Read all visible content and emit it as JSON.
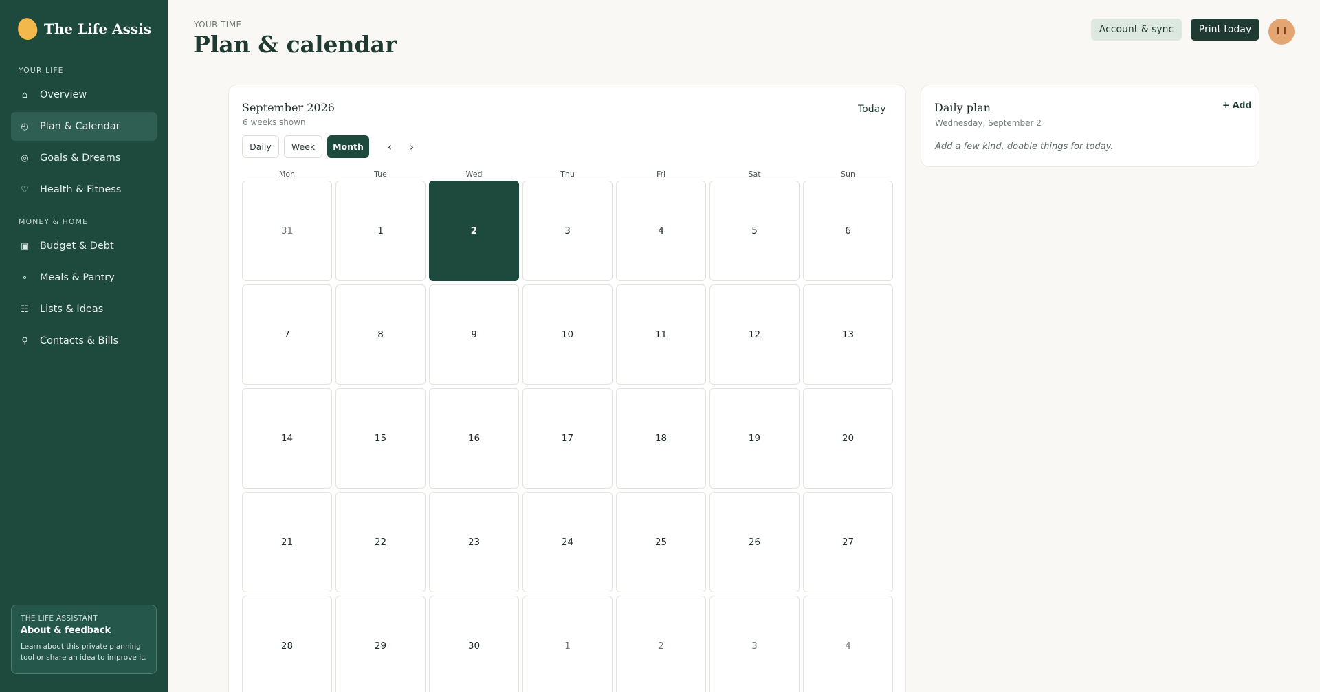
{
  "app": {
    "brand": "The Life Assist..."
  },
  "sidebar": {
    "section_life": "YOUR LIFE",
    "section_money": "MONEY & HOME",
    "items": [
      {
        "label": "Overview",
        "icon": "⌂",
        "icon_name": "home-icon"
      },
      {
        "label": "Plan & Calendar",
        "icon": "◴",
        "icon_name": "clock-icon"
      },
      {
        "label": "Goals & Dreams",
        "icon": "◎",
        "icon_name": "target-icon"
      },
      {
        "label": "Health & Fitness",
        "icon": "♡",
        "icon_name": "heart-icon"
      },
      {
        "label": "Budget & Debt",
        "icon": "▣",
        "icon_name": "wallet-icon"
      },
      {
        "label": "Meals & Pantry",
        "icon": "∘",
        "icon_name": "bowl-icon"
      },
      {
        "label": "Lists & Ideas",
        "icon": "☷",
        "icon_name": "list-icon"
      },
      {
        "label": "Contacts & Bills",
        "icon": "⚲",
        "icon_name": "contacts-icon"
      }
    ],
    "active_item": "Plan & Calendar",
    "about": {
      "kicker": "THE LIFE ASSISTANT",
      "title": "About & feedback",
      "description": "Learn about this private planning tool or share an idea to improve it."
    }
  },
  "header": {
    "kicker": "YOUR TIME",
    "title": "Plan & calendar",
    "account_label": "Account & sync",
    "print_label": "Print today",
    "avatar_initials": "I I"
  },
  "calendar": {
    "month_label": "September 2026",
    "subtitle": "6 weeks shown",
    "today_label": "Today",
    "views": [
      "Daily",
      "Week",
      "Month"
    ],
    "active_view": "Month",
    "prev_icon": "‹",
    "next_icon": "›",
    "weekdays": [
      "Mon",
      "Tue",
      "Wed",
      "Thu",
      "Fri",
      "Sat",
      "Sun"
    ],
    "weeks": [
      [
        {
          "d": "31",
          "m": true
        },
        {
          "d": "1"
        },
        {
          "d": "2",
          "t": true
        },
        {
          "d": "3"
        },
        {
          "d": "4"
        },
        {
          "d": "5"
        },
        {
          "d": "6"
        }
      ],
      [
        {
          "d": "7"
        },
        {
          "d": "8"
        },
        {
          "d": "9"
        },
        {
          "d": "10"
        },
        {
          "d": "11"
        },
        {
          "d": "12"
        },
        {
          "d": "13"
        }
      ],
      [
        {
          "d": "14"
        },
        {
          "d": "15"
        },
        {
          "d": "16"
        },
        {
          "d": "17"
        },
        {
          "d": "18"
        },
        {
          "d": "19"
        },
        {
          "d": "20"
        }
      ],
      [
        {
          "d": "21"
        },
        {
          "d": "22"
        },
        {
          "d": "23"
        },
        {
          "d": "24"
        },
        {
          "d": "25"
        },
        {
          "d": "26"
        },
        {
          "d": "27"
        }
      ],
      [
        {
          "d": "28"
        },
        {
          "d": "29"
        },
        {
          "d": "30"
        },
        {
          "d": "1",
          "m": true
        },
        {
          "d": "2",
          "m": true
        },
        {
          "d": "3",
          "m": true
        },
        {
          "d": "4",
          "m": true
        }
      ]
    ]
  },
  "daily_plan": {
    "title": "Daily plan",
    "date": "Wednesday, September 2",
    "add_label": "+ Add",
    "empty_text": "Add a few kind, doable things for today."
  },
  "colors": {
    "sidebar_bg": "#1e4a3e",
    "accent": "#1e4a3e",
    "brand_logo": "#f2b84b",
    "avatar": "#e3a673",
    "page_bg": "#faf8f4"
  }
}
